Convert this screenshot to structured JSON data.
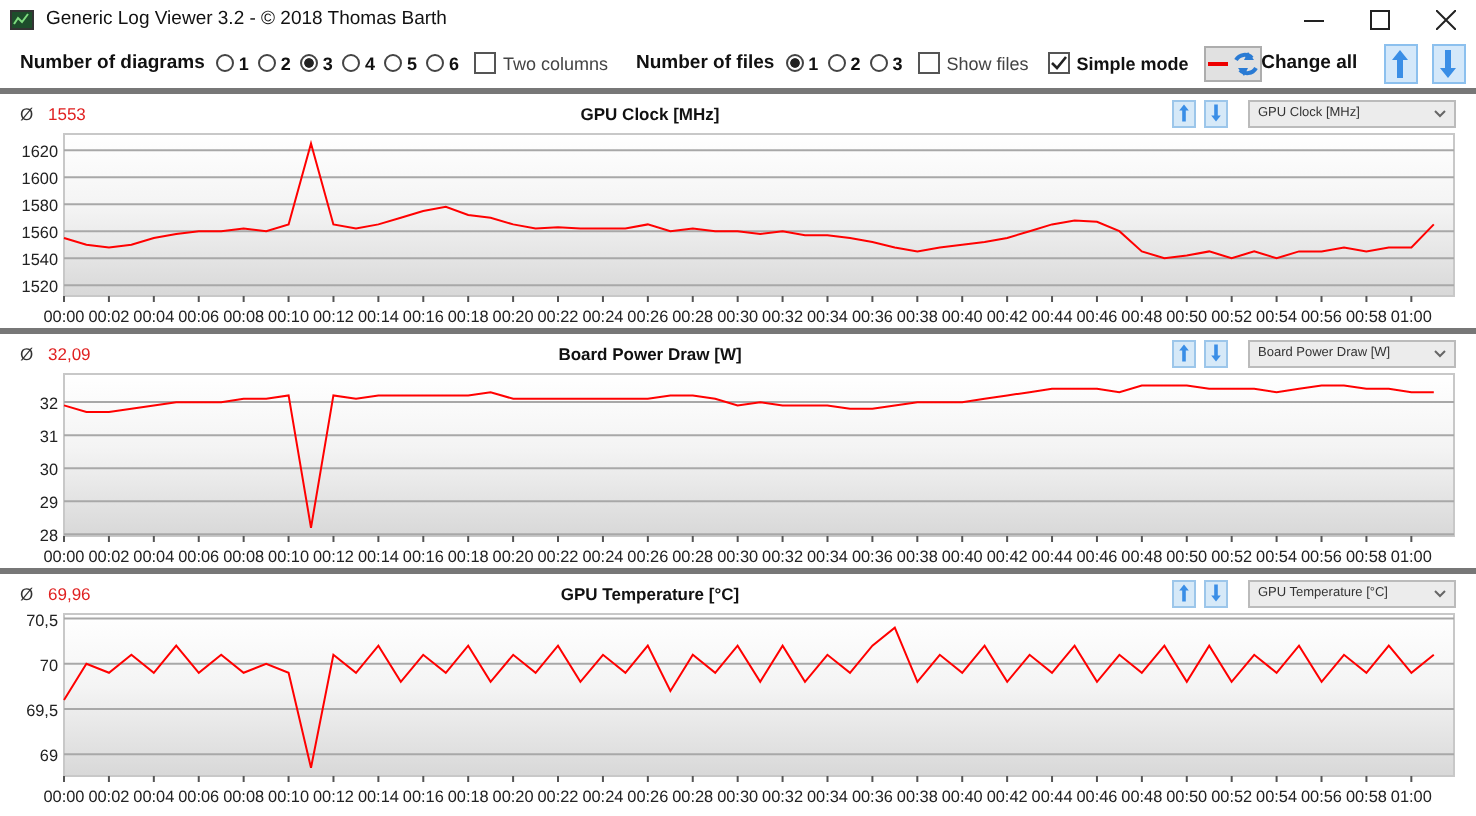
{
  "window": {
    "title": "Generic Log Viewer 3.2 - © 2018 Thomas Barth"
  },
  "toolbar": {
    "diagrams": {
      "label": "Number of diagrams",
      "options": [
        {
          "label": "1",
          "selected": false
        },
        {
          "label": "2",
          "selected": false
        },
        {
          "label": "3",
          "selected": true
        },
        {
          "label": "4",
          "selected": false
        },
        {
          "label": "5",
          "selected": false
        },
        {
          "label": "6",
          "selected": false
        }
      ]
    },
    "two_columns": {
      "label": "Two columns",
      "checked": false
    },
    "files": {
      "label": "Number of files",
      "options": [
        {
          "label": "1",
          "selected": true
        },
        {
          "label": "2",
          "selected": false
        },
        {
          "label": "3",
          "selected": false
        }
      ]
    },
    "show_files": {
      "label": "Show files",
      "checked": false
    },
    "simple_mode": {
      "label": "Simple mode",
      "checked": true
    },
    "change_all": {
      "label": "Change all"
    }
  },
  "panels": [
    {
      "avg_symbol": "Ø",
      "average": "1553",
      "title": "GPU Clock [MHz]",
      "selector": "GPU Clock [MHz]",
      "chart_data": {
        "type": "line",
        "x": [
          0,
          1,
          2,
          3,
          4,
          5,
          6,
          7,
          8,
          9,
          10,
          11,
          12,
          13,
          14,
          15,
          16,
          17,
          18,
          19,
          20,
          21,
          22,
          23,
          24,
          25,
          26,
          27,
          28,
          29,
          30,
          31,
          32,
          33,
          34,
          35,
          36,
          37,
          38,
          39,
          40,
          41,
          42,
          43,
          44,
          45,
          46,
          47,
          48,
          49,
          50,
          51,
          52,
          53,
          54,
          55,
          56,
          57,
          58,
          59,
          60,
          61
        ],
        "grid": true,
        "series": [
          {
            "color": "#ff0000",
            "values": [
              1555,
              1550,
              1548,
              1550,
              1555,
              1558,
              1560,
              1560,
              1562,
              1560,
              1565,
              1625,
              1565,
              1562,
              1565,
              1570,
              1575,
              1578,
              1572,
              1570,
              1565,
              1562,
              1563,
              1562,
              1562,
              1562,
              1565,
              1560,
              1562,
              1560,
              1560,
              1558,
              1560,
              1557,
              1557,
              1555,
              1552,
              1548,
              1545,
              1548,
              1550,
              1552,
              1555,
              1560,
              1565,
              1568,
              1567,
              1560,
              1545,
              1540,
              1542,
              1545,
              1540,
              1545,
              1540,
              1545,
              1545,
              1548,
              1545,
              1548,
              1548,
              1565
            ]
          }
        ],
        "xlim": [
          0,
          61.9
        ],
        "ylim": [
          1512,
          1632
        ],
        "xticks": [
          {
            "value": 0,
            "label": "00:00"
          },
          {
            "value": 2,
            "label": "00:02"
          },
          {
            "value": 4,
            "label": "00:04"
          },
          {
            "value": 6,
            "label": "00:06"
          },
          {
            "value": 8,
            "label": "00:08"
          },
          {
            "value": 10,
            "label": "00:10"
          },
          {
            "value": 12,
            "label": "00:12"
          },
          {
            "value": 14,
            "label": "00:14"
          },
          {
            "value": 16,
            "label": "00:16"
          },
          {
            "value": 18,
            "label": "00:18"
          },
          {
            "value": 20,
            "label": "00:20"
          },
          {
            "value": 22,
            "label": "00:22"
          },
          {
            "value": 24,
            "label": "00:24"
          },
          {
            "value": 26,
            "label": "00:26"
          },
          {
            "value": 28,
            "label": "00:28"
          },
          {
            "value": 30,
            "label": "00:30"
          },
          {
            "value": 32,
            "label": "00:32"
          },
          {
            "value": 34,
            "label": "00:34"
          },
          {
            "value": 36,
            "label": "00:36"
          },
          {
            "value": 38,
            "label": "00:38"
          },
          {
            "value": 40,
            "label": "00:40"
          },
          {
            "value": 42,
            "label": "00:42"
          },
          {
            "value": 44,
            "label": "00:44"
          },
          {
            "value": 46,
            "label": "00:46"
          },
          {
            "value": 48,
            "label": "00:48"
          },
          {
            "value": 50,
            "label": "00:50"
          },
          {
            "value": 52,
            "label": "00:52"
          },
          {
            "value": 54,
            "label": "00:54"
          },
          {
            "value": 56,
            "label": "00:56"
          },
          {
            "value": 58,
            "label": "00:58"
          },
          {
            "value": 60,
            "label": "01:00"
          }
        ],
        "yticks": [
          1520,
          1540,
          1560,
          1580,
          1600,
          1620
        ]
      }
    },
    {
      "avg_symbol": "Ø",
      "average": "32,09",
      "title": "Board Power Draw [W]",
      "selector": "Board Power Draw [W]",
      "chart_data": {
        "type": "line",
        "x": [
          0,
          1,
          2,
          3,
          4,
          5,
          6,
          7,
          8,
          9,
          10,
          11,
          12,
          13,
          14,
          15,
          16,
          17,
          18,
          19,
          20,
          21,
          22,
          23,
          24,
          25,
          26,
          27,
          28,
          29,
          30,
          31,
          32,
          33,
          34,
          35,
          36,
          37,
          38,
          39,
          40,
          41,
          42,
          43,
          44,
          45,
          46,
          47,
          48,
          49,
          50,
          51,
          52,
          53,
          54,
          55,
          56,
          57,
          58,
          59,
          60,
          61
        ],
        "grid": true,
        "series": [
          {
            "color": "#ff0000",
            "values": [
              31.9,
              31.7,
              31.7,
              31.8,
              31.9,
              32,
              32,
              32,
              32.1,
              32.1,
              32.2,
              28.2,
              32.2,
              32.1,
              32.2,
              32.2,
              32.2,
              32.2,
              32.2,
              32.3,
              32.1,
              32.1,
              32.1,
              32.1,
              32.1,
              32.1,
              32.1,
              32.2,
              32.2,
              32.1,
              31.9,
              32,
              31.9,
              31.9,
              31.9,
              31.8,
              31.8,
              31.9,
              32,
              32,
              32,
              32.1,
              32.2,
              32.3,
              32.4,
              32.4,
              32.4,
              32.3,
              32.5,
              32.5,
              32.5,
              32.4,
              32.4,
              32.4,
              32.3,
              32.4,
              32.5,
              32.5,
              32.4,
              32.4,
              32.3,
              32.3
            ]
          }
        ],
        "xlim": [
          0,
          61.9
        ],
        "ylim": [
          27.95,
          32.85
        ],
        "xticks": [
          {
            "value": 0,
            "label": "00:00"
          },
          {
            "value": 2,
            "label": "00:02"
          },
          {
            "value": 4,
            "label": "00:04"
          },
          {
            "value": 6,
            "label": "00:06"
          },
          {
            "value": 8,
            "label": "00:08"
          },
          {
            "value": 10,
            "label": "00:10"
          },
          {
            "value": 12,
            "label": "00:12"
          },
          {
            "value": 14,
            "label": "00:14"
          },
          {
            "value": 16,
            "label": "00:16"
          },
          {
            "value": 18,
            "label": "00:18"
          },
          {
            "value": 20,
            "label": "00:20"
          },
          {
            "value": 22,
            "label": "00:22"
          },
          {
            "value": 24,
            "label": "00:24"
          },
          {
            "value": 26,
            "label": "00:26"
          },
          {
            "value": 28,
            "label": "00:28"
          },
          {
            "value": 30,
            "label": "00:30"
          },
          {
            "value": 32,
            "label": "00:32"
          },
          {
            "value": 34,
            "label": "00:34"
          },
          {
            "value": 36,
            "label": "00:36"
          },
          {
            "value": 38,
            "label": "00:38"
          },
          {
            "value": 40,
            "label": "00:40"
          },
          {
            "value": 42,
            "label": "00:42"
          },
          {
            "value": 44,
            "label": "00:44"
          },
          {
            "value": 46,
            "label": "00:46"
          },
          {
            "value": 48,
            "label": "00:48"
          },
          {
            "value": 50,
            "label": "00:50"
          },
          {
            "value": 52,
            "label": "00:52"
          },
          {
            "value": 54,
            "label": "00:54"
          },
          {
            "value": 56,
            "label": "00:56"
          },
          {
            "value": 58,
            "label": "00:58"
          },
          {
            "value": 60,
            "label": "01:00"
          }
        ],
        "yticks": [
          28,
          29,
          30,
          31,
          32
        ]
      }
    },
    {
      "avg_symbol": "Ø",
      "average": "69,96",
      "title": "GPU Temperature [°C]",
      "selector": "GPU Temperature [°C]",
      "chart_data": {
        "type": "line",
        "x": [
          0,
          1,
          2,
          3,
          4,
          5,
          6,
          7,
          8,
          9,
          10,
          11,
          12,
          13,
          14,
          15,
          16,
          17,
          18,
          19,
          20,
          21,
          22,
          23,
          24,
          25,
          26,
          27,
          28,
          29,
          30,
          31,
          32,
          33,
          34,
          35,
          36,
          37,
          38,
          39,
          40,
          41,
          42,
          43,
          44,
          45,
          46,
          47,
          48,
          49,
          50,
          51,
          52,
          53,
          54,
          55,
          56,
          57,
          58,
          59,
          60,
          61
        ],
        "grid": true,
        "series": [
          {
            "color": "#ff0000",
            "values": [
              69.6,
              70.0,
              69.9,
              70.1,
              69.9,
              70.2,
              69.9,
              70.1,
              69.9,
              70.0,
              69.9,
              68.85,
              70.1,
              69.9,
              70.2,
              69.8,
              70.1,
              69.9,
              70.2,
              69.8,
              70.1,
              69.9,
              70.2,
              69.8,
              70.1,
              69.9,
              70.2,
              69.7,
              70.1,
              69.9,
              70.2,
              69.8,
              70.2,
              69.8,
              70.1,
              69.9,
              70.2,
              70.4,
              69.8,
              70.1,
              69.9,
              70.2,
              69.8,
              70.1,
              69.9,
              70.2,
              69.8,
              70.1,
              69.9,
              70.2,
              69.8,
              70.2,
              69.8,
              70.1,
              69.9,
              70.2,
              69.8,
              70.1,
              69.9,
              70.2,
              69.9,
              70.1
            ]
          }
        ],
        "xlim": [
          0,
          61.9
        ],
        "ylim": [
          68.76,
          70.55
        ],
        "xticks": [
          {
            "value": 0,
            "label": "00:00"
          },
          {
            "value": 2,
            "label": "00:02"
          },
          {
            "value": 4,
            "label": "00:04"
          },
          {
            "value": 6,
            "label": "00:06"
          },
          {
            "value": 8,
            "label": "00:08"
          },
          {
            "value": 10,
            "label": "00:10"
          },
          {
            "value": 12,
            "label": "00:12"
          },
          {
            "value": 14,
            "label": "00:14"
          },
          {
            "value": 16,
            "label": "00:16"
          },
          {
            "value": 18,
            "label": "00:18"
          },
          {
            "value": 20,
            "label": "00:20"
          },
          {
            "value": 22,
            "label": "00:22"
          },
          {
            "value": 24,
            "label": "00:24"
          },
          {
            "value": 26,
            "label": "00:26"
          },
          {
            "value": 28,
            "label": "00:28"
          },
          {
            "value": 30,
            "label": "00:30"
          },
          {
            "value": 32,
            "label": "00:32"
          },
          {
            "value": 34,
            "label": "00:34"
          },
          {
            "value": 36,
            "label": "00:36"
          },
          {
            "value": 38,
            "label": "00:38"
          },
          {
            "value": 40,
            "label": "00:40"
          },
          {
            "value": 42,
            "label": "00:42"
          },
          {
            "value": 44,
            "label": "00:44"
          },
          {
            "value": 46,
            "label": "00:46"
          },
          {
            "value": 48,
            "label": "00:48"
          },
          {
            "value": 50,
            "label": "00:50"
          },
          {
            "value": 52,
            "label": "00:52"
          },
          {
            "value": 54,
            "label": "00:54"
          },
          {
            "value": 56,
            "label": "00:56"
          },
          {
            "value": 58,
            "label": "00:58"
          },
          {
            "value": 60,
            "label": "01:00"
          }
        ],
        "yticks": [
          69,
          {
            "value": 69.5,
            "label": "69,5"
          },
          70,
          {
            "value": 70.5,
            "label": "70,5"
          }
        ]
      }
    }
  ]
}
